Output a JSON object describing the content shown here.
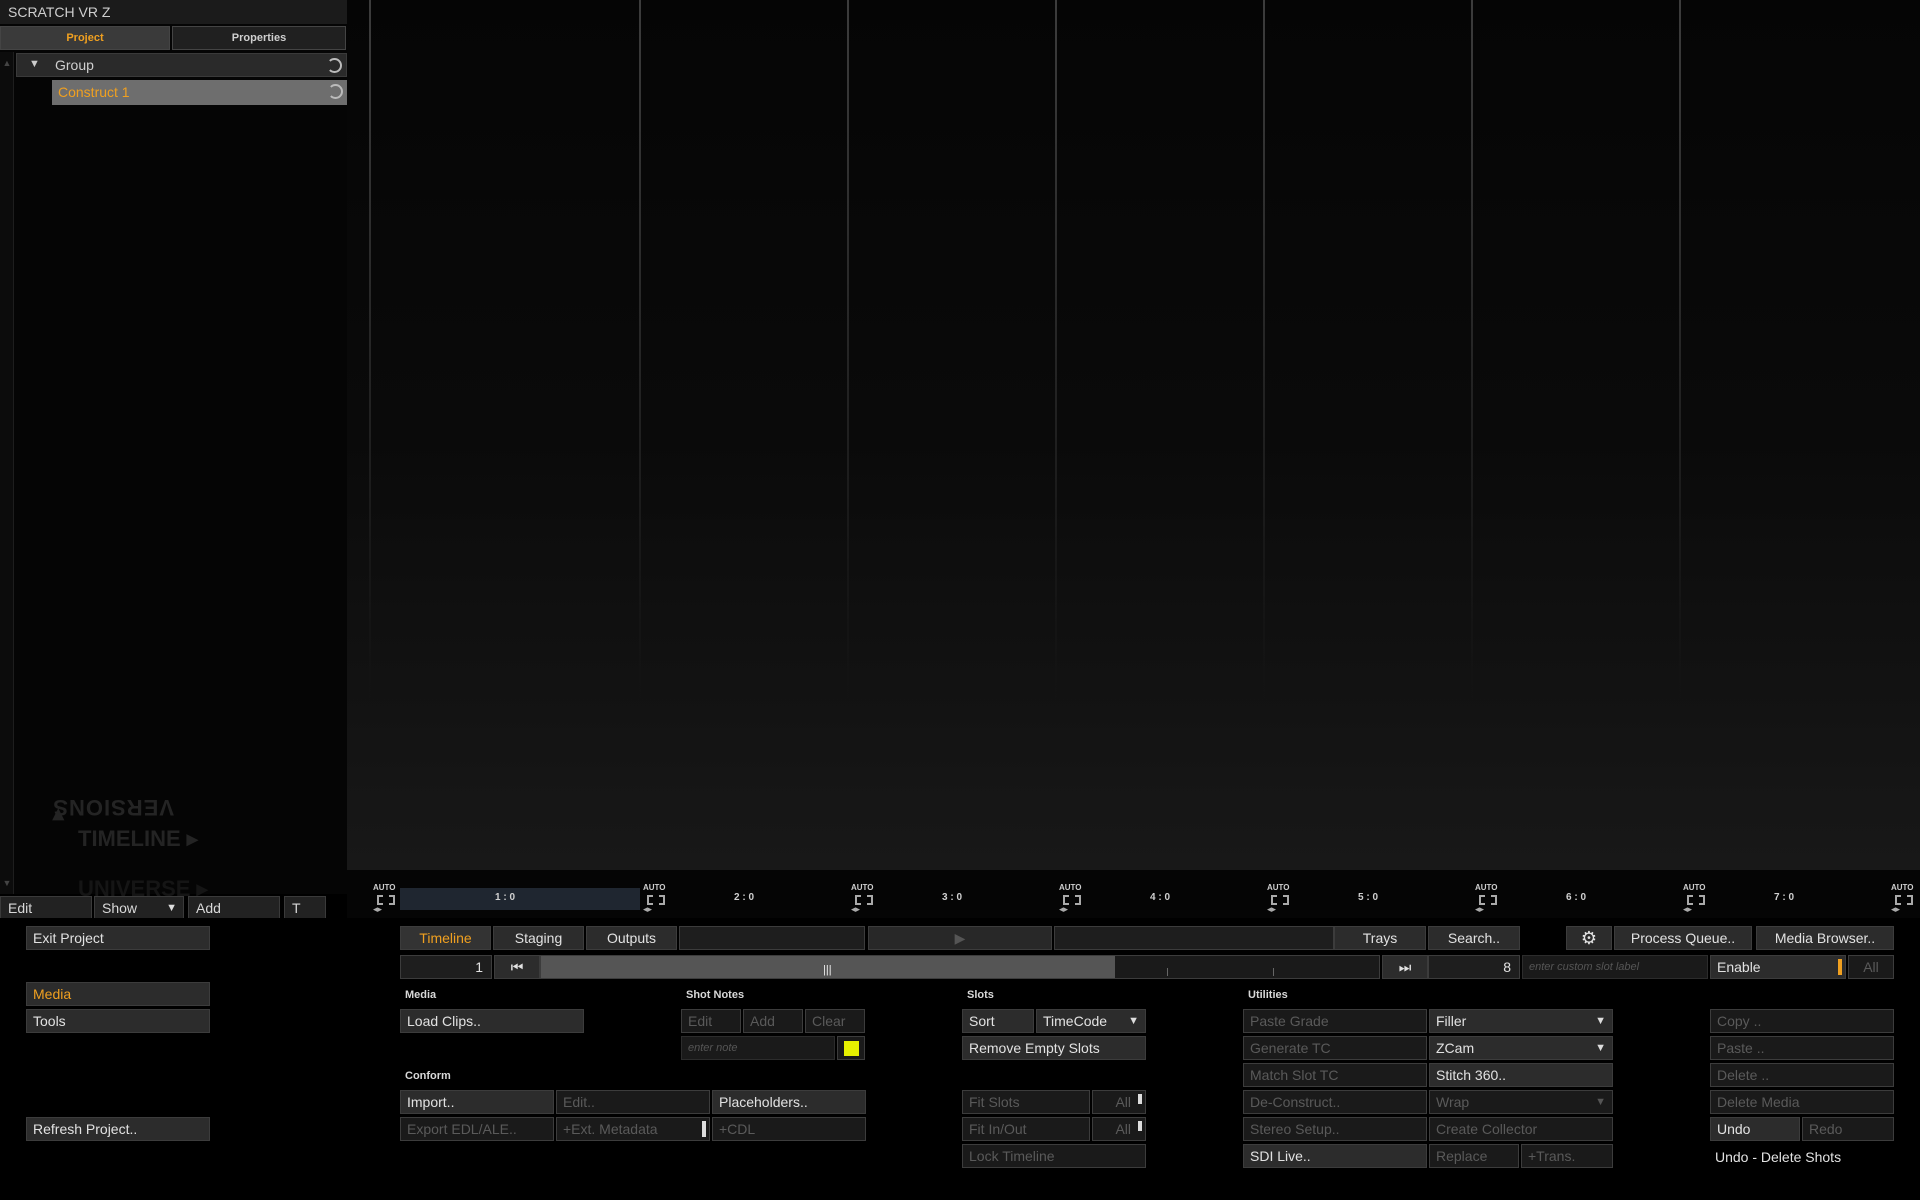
{
  "app_title": "SCRATCH VR Z",
  "left_tabs": {
    "project": "Project",
    "properties": "Properties"
  },
  "tree": {
    "group_label": "Group",
    "construct_label": "Construct 1"
  },
  "left_panel": {
    "versions_label": "VERSIONS",
    "timeline_label": "TIMELINE",
    "timeline_label_2": "UNIVERSE",
    "edit_label": "Edit",
    "show_label": "Show",
    "add_label": "Add",
    "t_label": "T"
  },
  "slots": {
    "auto_label": "AUTO",
    "labels": [
      "1 : 0",
      "2 : 0",
      "3 : 0",
      "4 : 0",
      "5 : 0",
      "6 : 0",
      "7 : 0"
    ]
  },
  "nav": {
    "exit_project": "Exit Project",
    "timeline_tab": "Timeline",
    "staging_tab": "Staging",
    "outputs_tab": "Outputs",
    "trays": "Trays",
    "search": "Search..",
    "process_queue": "Process Queue..",
    "media_browser": "Media Browser.."
  },
  "scrubber": {
    "start_slot": "1",
    "end_slot": "8",
    "slot_label_placeholder": "enter custom slot label",
    "enable": "Enable",
    "all": "All"
  },
  "left_menu": {
    "media": "Media",
    "tools": "Tools",
    "refresh_project": "Refresh Project.."
  },
  "media_section": {
    "label": "Media",
    "load_clips": "Load Clips.."
  },
  "shot_notes": {
    "label": "Shot Notes",
    "edit": "Edit",
    "add": "Add",
    "clear": "Clear",
    "note_placeholder": "enter note",
    "swatch_color": "#e6f000"
  },
  "conform": {
    "label": "Conform",
    "import": "Import..",
    "edit": "Edit..",
    "placeholders": "Placeholders..",
    "export_edl": "Export EDL/ALE..",
    "ext_metadata": "+Ext. Metadata",
    "cdl": "+CDL"
  },
  "slots_section": {
    "label": "Slots",
    "sort": "Sort",
    "sort_mode": "TimeCode",
    "remove_empty": "Remove Empty Slots",
    "fit_slots": "Fit Slots",
    "fit_in_out": "Fit In/Out",
    "all": "All",
    "lock_timeline": "Lock Timeline"
  },
  "utilities": {
    "label": "Utilities",
    "paste_grade": "Paste Grade",
    "filler": "Filler",
    "generate_tc": "Generate TC",
    "zcam": "ZCam",
    "match_slot_tc": "Match Slot TC",
    "stitch_360": "Stitch 360..",
    "deconstruct": "De-Construct..",
    "wrap": "Wrap",
    "stereo_setup": "Stereo Setup..",
    "create_collector": "Create Collector",
    "sdi_live": "SDI Live..",
    "replace": "Replace",
    "trans": "+Trans."
  },
  "edit_ops": {
    "copy": "Copy ..",
    "paste": "Paste ..",
    "delete": "Delete ..",
    "delete_media": "Delete Media",
    "undo": "Undo",
    "redo": "Redo",
    "undo_status": "Undo - Delete Shots"
  },
  "colors": {
    "accent": "#f0a020",
    "panel": "#2c2c2c",
    "disabled_text": "#5a5a5a"
  }
}
